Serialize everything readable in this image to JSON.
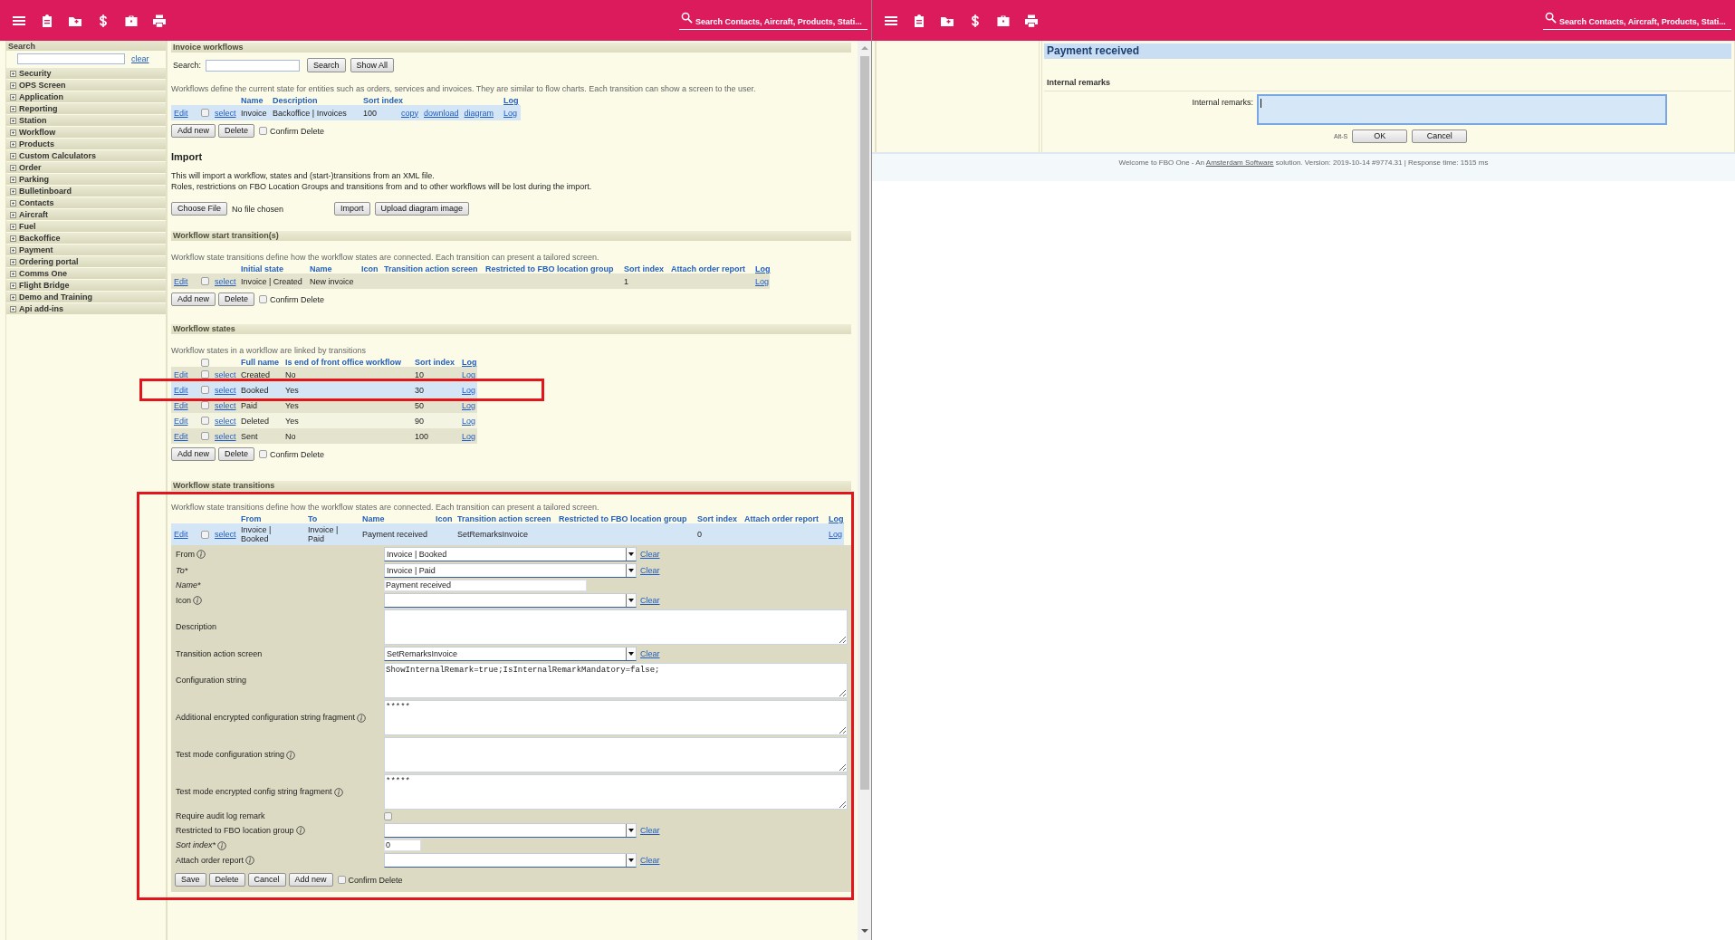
{
  "left_pane": {
    "header": {
      "search_placeholder": "Search Contacts, Aircraft, Products, Stati..."
    },
    "sidebar": {
      "title": "Search",
      "clear_link": "clear",
      "items": [
        "Security",
        "OPS Screen",
        "Application",
        "Reporting",
        "Station",
        "Workflow",
        "Products",
        "Custom Calculators",
        "Order",
        "Parking",
        "Bulletinboard",
        "Contacts",
        "Aircraft",
        "Fuel",
        "Backoffice",
        "Payment",
        "Ordering portal",
        "Comms One",
        "Flight Bridge",
        "Demo and Training",
        "Api add-ins"
      ]
    },
    "workflows": {
      "title": "Invoice workflows",
      "search_label": "Search:",
      "buttons": [
        "Search",
        "Show All"
      ],
      "description": "Workflows define the current state for entities such as orders, services and invoices. They are similar to flow charts. Each transition can show a screen to the user.",
      "table": {
        "columns": [
          "Name",
          "Description",
          "Sort index"
        ],
        "log_header": "Log",
        "rows": [
          {
            "edit": "Edit",
            "checked": false,
            "select": "select",
            "cells": [
              "Invoice",
              "Backoffice | Invoices",
              "100"
            ],
            "links": [
              "copy",
              "download",
              "diagram"
            ],
            "log": "Log",
            "selected": true
          }
        ]
      },
      "actions": {
        "buttons": [
          "Add new",
          "Delete"
        ],
        "confirm": "Confirm Delete",
        "checked": false
      }
    },
    "import": {
      "title": "Import",
      "lines": [
        "This will import a workflow, states and (start-)transitions from an XML file.",
        "Roles, restrictions on FBO Location Groups and transitions from and to other workflows will be lost during the import."
      ],
      "file_button": "Choose File",
      "file_status": "No file chosen",
      "buttons": [
        "Import",
        "Upload diagram image"
      ]
    },
    "start_transitions": {
      "title": "Workflow start transition(s)",
      "description": "Workflow state transitions define how the workflow states are connected. Each transition can present a tailored screen.",
      "table": {
        "columns": [
          "Initial state",
          "Name",
          "Icon",
          "Transition action screen",
          "Restricted to FBO location group",
          "Sort index",
          "Attach order report"
        ],
        "log_header": "Log",
        "rows": [
          {
            "edit": "Edit",
            "checked": false,
            "select": "select",
            "cells": [
              "Invoice | Created",
              "New invoice",
              null,
              null,
              null,
              "1",
              null
            ],
            "log": "Log",
            "selected": false
          }
        ]
      },
      "actions": {
        "buttons": [
          "Add new",
          "Delete"
        ],
        "confirm": "Confirm Delete",
        "checked": false
      }
    },
    "states": {
      "title": "Workflow states",
      "description": "Workflow states in a workflow are linked by transitions",
      "table": {
        "header_checkbox": {
          "checked": false
        },
        "columns": [
          "Full name",
          "Is end of front office workflow",
          "Sort index"
        ],
        "log_header": "Log",
        "rows": [
          {
            "edit": "Edit",
            "checked": false,
            "select": "select",
            "cells": [
              "Created",
              "No",
              "10"
            ],
            "log": "Log",
            "selected": false,
            "highlighted": false
          },
          {
            "edit": "Edit",
            "checked": false,
            "select": "select",
            "cells": [
              "Booked",
              "Yes",
              "30"
            ],
            "log": "Log",
            "selected": true,
            "highlighted": true
          },
          {
            "edit": "Edit",
            "checked": false,
            "select": "select",
            "cells": [
              "Paid",
              "Yes",
              "50"
            ],
            "log": "Log",
            "selected": false,
            "highlighted": false
          },
          {
            "edit": "Edit",
            "checked": false,
            "select": "select",
            "cells": [
              "Deleted",
              "Yes",
              "90"
            ],
            "log": "Log",
            "selected": false,
            "highlighted": false
          },
          {
            "edit": "Edit",
            "checked": false,
            "select": "select",
            "cells": [
              "Sent",
              "No",
              "100"
            ],
            "log": "Log",
            "selected": false,
            "highlighted": false
          }
        ]
      },
      "actions": {
        "buttons": [
          "Add new",
          "Delete"
        ],
        "confirm": "Confirm Delete",
        "checked": false
      }
    },
    "transitions": {
      "title": "Workflow state transitions",
      "highlighted": true,
      "description": "Workflow state transitions define how the workflow states are connected. Each transition can present a tailored screen.",
      "table": {
        "columns": [
          "From",
          "To",
          "Name",
          "Icon",
          "Transition action screen",
          "Restricted to FBO location group",
          "Sort index",
          "Attach order report"
        ],
        "log_header": "Log",
        "rows": [
          {
            "edit": "Edit",
            "checked": false,
            "select": "select",
            "cells": [
              "Invoice | Booked",
              "Invoice | Paid",
              "Payment received",
              null,
              "SetRemarksInvoice",
              null,
              "0",
              null
            ],
            "log": "Log",
            "selected": true
          }
        ]
      },
      "form": {
        "fields": [
          {
            "kind": "select",
            "label": "From",
            "info": true,
            "required": false,
            "value": "Invoice | Booked",
            "clear": "Clear"
          },
          {
            "kind": "select",
            "label": "To*",
            "info": false,
            "required": true,
            "value": "Invoice | Paid",
            "clear": "Clear"
          },
          {
            "kind": "input",
            "label": "Name*",
            "info": false,
            "required": true,
            "value": "Payment received"
          },
          {
            "kind": "select",
            "label": "Icon",
            "info": true,
            "required": false,
            "clear": "Clear"
          },
          {
            "kind": "textarea",
            "label": "Description",
            "info": false,
            "required": false
          },
          {
            "kind": "select",
            "label": "Transition action screen",
            "info": false,
            "required": false,
            "value": "SetRemarksInvoice",
            "clear": "Clear"
          },
          {
            "kind": "textarea",
            "label": "Configuration string",
            "info": false,
            "required": false,
            "value": "ShowInternalRemark=true;IsInternalRemarkMandatory=false;"
          },
          {
            "kind": "textarea",
            "label": "Additional encrypted configuration string fragment",
            "info": true,
            "required": false,
            "value": "*****"
          },
          {
            "kind": "textarea",
            "label": "Test mode configuration string",
            "info": true,
            "required": false
          },
          {
            "kind": "textarea",
            "label": "Test mode encrypted config string fragment",
            "info": true,
            "required": false,
            "value": "*****"
          },
          {
            "kind": "checkbox",
            "label": "Require audit log remark",
            "info": false,
            "required": false,
            "checked": false
          },
          {
            "kind": "select",
            "label": "Restricted to FBO location group",
            "info": true,
            "required": false,
            "clear": "Clear"
          },
          {
            "kind": "number",
            "label": "Sort index*",
            "info": true,
            "required": true,
            "value": "0"
          },
          {
            "kind": "select",
            "label": "Attach order report",
            "info": true,
            "required": false,
            "clear": "Clear"
          }
        ],
        "buttons": [
          "Save",
          "Delete",
          "Cancel",
          "Add new"
        ],
        "confirm": "Confirm Delete",
        "checked": false
      }
    }
  },
  "right_pane": {
    "header": {
      "search_placeholder": "Search Contacts, Aircraft, Products, Stati..."
    },
    "dialog": {
      "title": "Payment received",
      "section": "Internal remarks",
      "field_label": "Internal remarks:",
      "field_focused": true,
      "shortcut": "Alt-S",
      "buttons": [
        "OK",
        "Cancel"
      ]
    },
    "footer": {
      "text_before": "Welcome to FBO One - An ",
      "link": "Amsterdam Software",
      "text_after": " solution. Version: 2019-10-14 #9774.31 | Response time: 1515 ms"
    }
  }
}
